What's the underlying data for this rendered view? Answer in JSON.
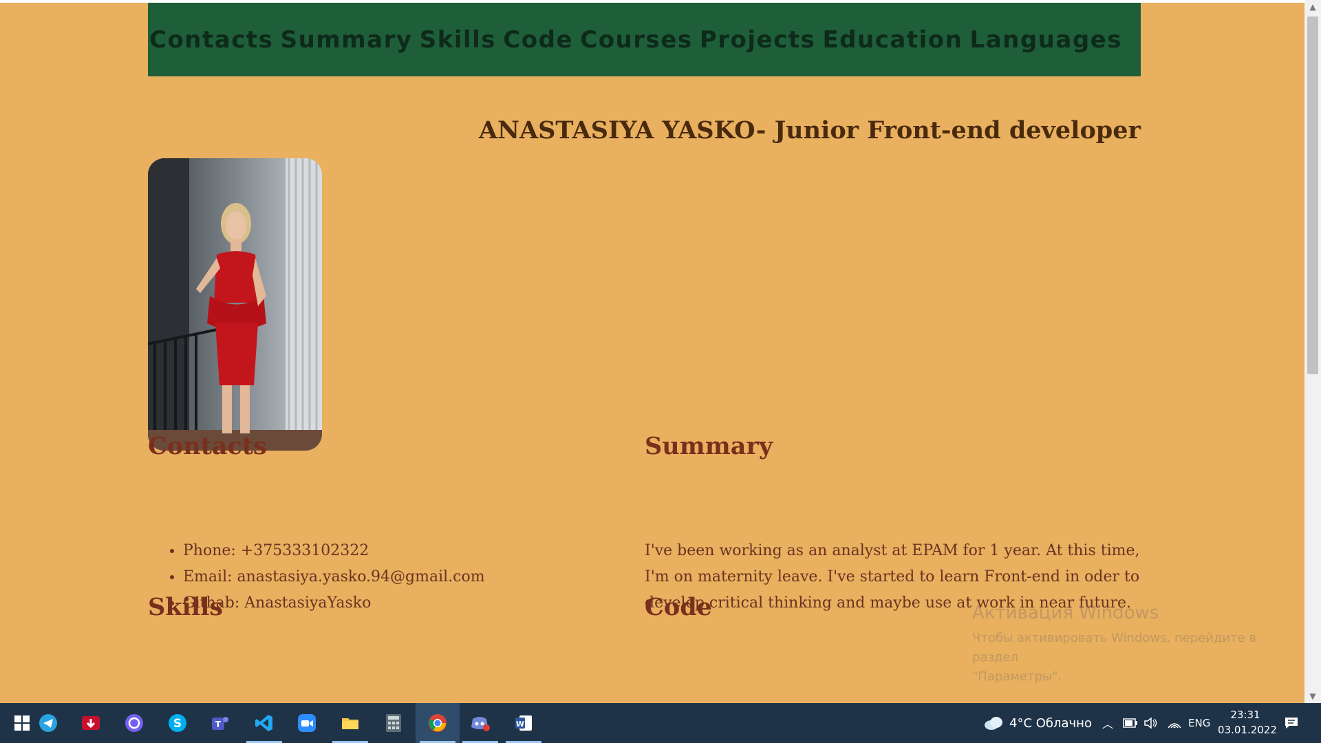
{
  "nav": {
    "items": [
      "Contacts",
      "Summary",
      "Skills",
      "Code",
      "Courses",
      "Projects",
      "Education",
      "Languages"
    ]
  },
  "page_title": "ANASTASIYA YASKO- Junior Front-end developer",
  "photo_alt": "Profile photo",
  "sections": {
    "contacts": {
      "heading": "Contacts",
      "items": [
        "Phone: +375333102322",
        "Email: anastasiya.yasko.94@gmail.com",
        "Githab: AnastasiyaYasko"
      ]
    },
    "summary": {
      "heading": "Summary",
      "text": "I've been working as an analyst at EPAM for 1 year. At this time, I'm on maternity leave. I've started to learn Front-end in oder to develop critical thinking and maybe use at work in near future."
    },
    "skills": {
      "heading": "Skills"
    },
    "code": {
      "heading": "Code"
    }
  },
  "watermark": {
    "title": "Активация Windows",
    "line1": "Чтобы активировать Windows, перейдите в раздел",
    "line2": "\"Параметры\"."
  },
  "taskbar": {
    "apps": [
      "windows-start",
      "telegram",
      "download-manager",
      "viber",
      "skype",
      "teams",
      "vscode",
      "zoom",
      "file-explorer",
      "calculator",
      "chrome",
      "discord",
      "word"
    ],
    "weather": "4°C Облачно",
    "language": "ENG",
    "time": "23:31",
    "date": "03.01.2022"
  },
  "colors": {
    "page_bg": "#E8B05F",
    "nav_bg": "#1E5F3A",
    "heading": "#7A2F1C",
    "taskbar_bg": "#1F3348"
  }
}
